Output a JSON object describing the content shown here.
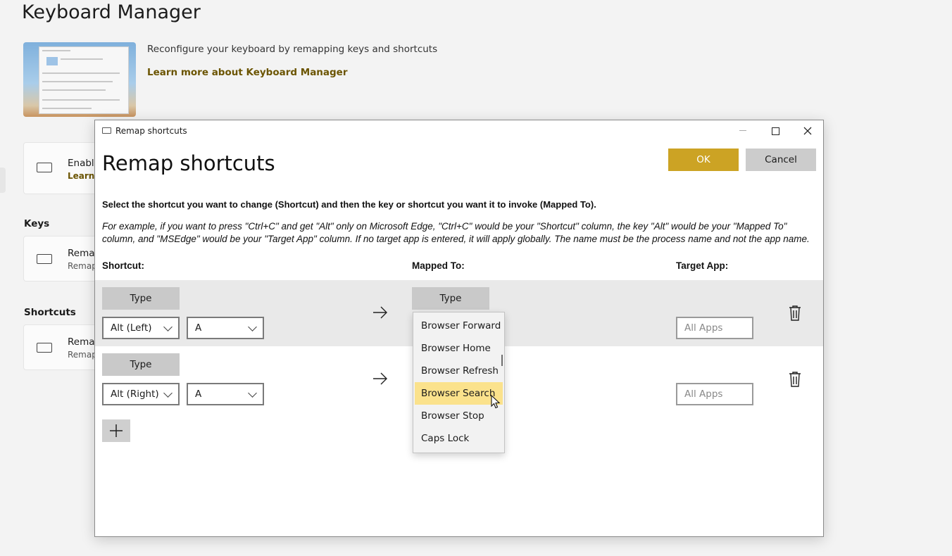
{
  "page": {
    "title": "Keyboard Manager",
    "description": "Reconfigure your keyboard by remapping keys and shortcuts",
    "learn_more": "Learn more about Keyboard Manager",
    "enable_card": {
      "title": "Enable",
      "link": "Learn m"
    },
    "keys_section": "Keys",
    "keys_card": {
      "title": "Remap",
      "subtitle": "Remap k"
    },
    "shortcuts_section": "Shortcuts",
    "shortcuts_card": {
      "title": "Remap",
      "subtitle": "Remap s"
    }
  },
  "dialog": {
    "window_title": "Remap shortcuts",
    "heading": "Remap shortcuts",
    "ok_label": "OK",
    "cancel_label": "Cancel",
    "instruction": "Select the shortcut you want to change (Shortcut) and then the key or shortcut you want it to invoke (Mapped To).",
    "example": "For example, if you want to press \"Ctrl+C\" and get \"Alt\" only on Microsoft Edge, \"Ctrl+C\" would be your \"Shortcut\" column, the key \"Alt\" would be your \"Mapped To\" column, and \"MSEdge\" would be your \"Target App\" column. If no target app is entered, it will apply globally. The name must be the process name and not the app name.",
    "columns": {
      "shortcut": "Shortcut:",
      "mapped_to": "Mapped To:",
      "target_app": "Target App:"
    },
    "rows": [
      {
        "type_label": "Type",
        "modifier": "Alt (Left)",
        "key": "A",
        "mapped_type_label": "Type",
        "target_placeholder": "All Apps"
      },
      {
        "type_label": "Type",
        "modifier": "Alt (Right)",
        "key": "A",
        "target_placeholder": "All Apps"
      }
    ],
    "dropdown": {
      "items": [
        "Browser Forward",
        "Browser Home",
        "Browser Refresh",
        "Browser Search",
        "Browser Stop",
        "Caps Lock"
      ],
      "highlighted": "Browser Search"
    }
  },
  "colors": {
    "accent": "#cca324",
    "highlight": "#fbe28c",
    "link": "#6b5400"
  }
}
